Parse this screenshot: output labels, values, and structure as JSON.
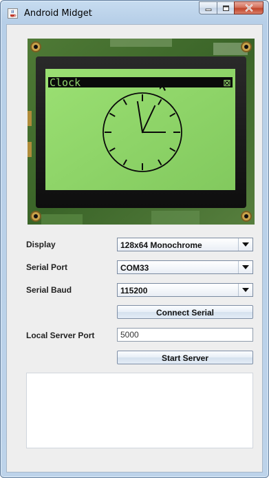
{
  "window": {
    "title": "Android Midget"
  },
  "icons": {
    "app": "java-cup-icon",
    "minimize": "minimize-icon",
    "maximize": "maximize-icon",
    "close": "close-icon",
    "dropdown": "chevron-down-icon"
  },
  "lcd": {
    "header_text": "Clock",
    "close_glyph": "⊠"
  },
  "form": {
    "display_label": "Display",
    "display_value": "128x64 Monochrome",
    "serial_port_label": "Serial Port",
    "serial_port_value": "COM33",
    "serial_baud_label": "Serial Baud",
    "serial_baud_value": "115200",
    "connect_button": "Connect Serial",
    "local_port_label": "Local Server Port",
    "local_port_value": "5000",
    "start_button": "Start Server"
  },
  "log": {
    "text": ""
  },
  "colors": {
    "lcd_green": "#8fd46b",
    "pcb_green": "#3d6b2c",
    "titlebar": "#bcd3ea"
  }
}
